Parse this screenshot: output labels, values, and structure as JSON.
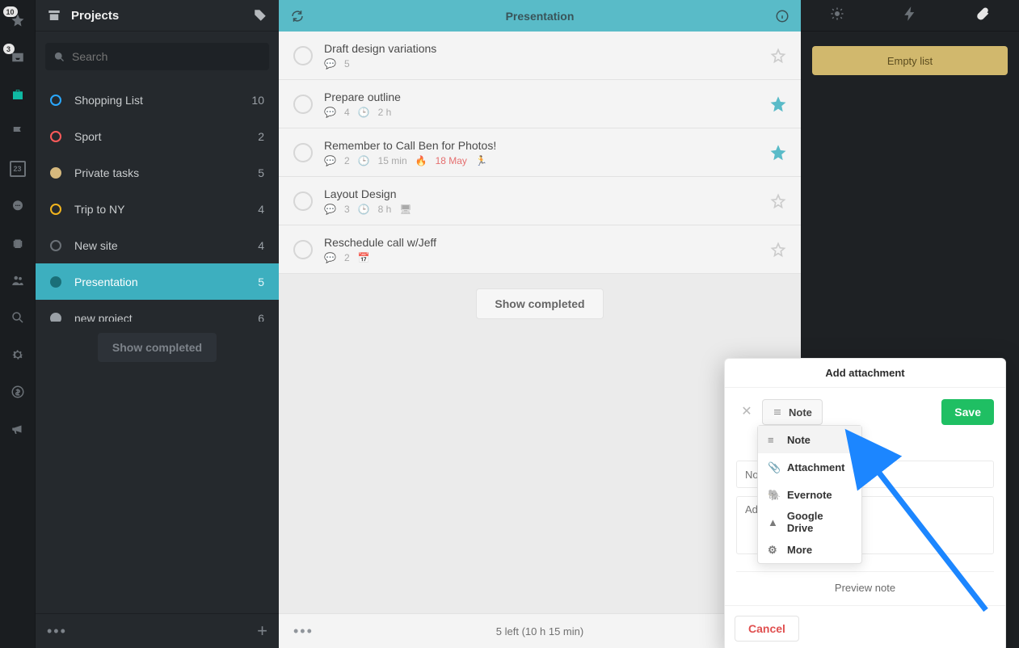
{
  "rail": {
    "star_badge": "10",
    "inbox_badge": "3",
    "calendar_day": "23"
  },
  "sidebar": {
    "title": "Projects",
    "search_placeholder": "Search",
    "projects": [
      {
        "name": "Shopping List",
        "count": "10",
        "color": "#2aa8ff",
        "fill": false
      },
      {
        "name": "Sport",
        "count": "2",
        "color": "#ff5a5a",
        "fill": false
      },
      {
        "name": "Private tasks",
        "count": "5",
        "color": "#d6b97e",
        "fill": true
      },
      {
        "name": "Trip to NY",
        "count": "4",
        "color": "#f2b41e",
        "fill": false
      },
      {
        "name": "New site",
        "count": "4",
        "color": "#6b7177",
        "fill": false
      },
      {
        "name": "Presentation",
        "count": "5",
        "color": "#1a6f78",
        "fill": true,
        "selected": true
      },
      {
        "name": "new project",
        "count": "6",
        "color": "#9aa0a6",
        "fill": true
      }
    ],
    "show_completed": "Show completed"
  },
  "main": {
    "title": "Presentation",
    "tasks": [
      {
        "title": "Draft design variations",
        "comments": "5"
      },
      {
        "title": "Prepare outline",
        "comments": "4",
        "time": "2 h",
        "starred": true
      },
      {
        "title": "Remember to Call Ben for Photos!",
        "comments": "2",
        "time": "15 min",
        "urgent_date": "18 May",
        "fire": true,
        "activity": true,
        "starred": true
      },
      {
        "title": "Layout Design",
        "comments": "3",
        "time": "8 h",
        "device": true
      },
      {
        "title": "Reschedule call w/Jeff",
        "comments": "2",
        "calendar": true
      }
    ],
    "show_completed": "Show completed",
    "footer_status": "5 left (10 h 15 min)"
  },
  "right": {
    "empty_label": "Empty list"
  },
  "modal": {
    "title": "Add attachment",
    "type_label": "Note",
    "save_label": "Save",
    "note_placeholder": "Note...",
    "desc_placeholder": "Add description",
    "preview_label": "Preview note",
    "cancel_label": "Cancel",
    "dropdown": [
      {
        "label": "Note"
      },
      {
        "label": "Attachment"
      },
      {
        "label": "Evernote"
      },
      {
        "label": "Google Drive"
      },
      {
        "label": "More"
      }
    ]
  }
}
